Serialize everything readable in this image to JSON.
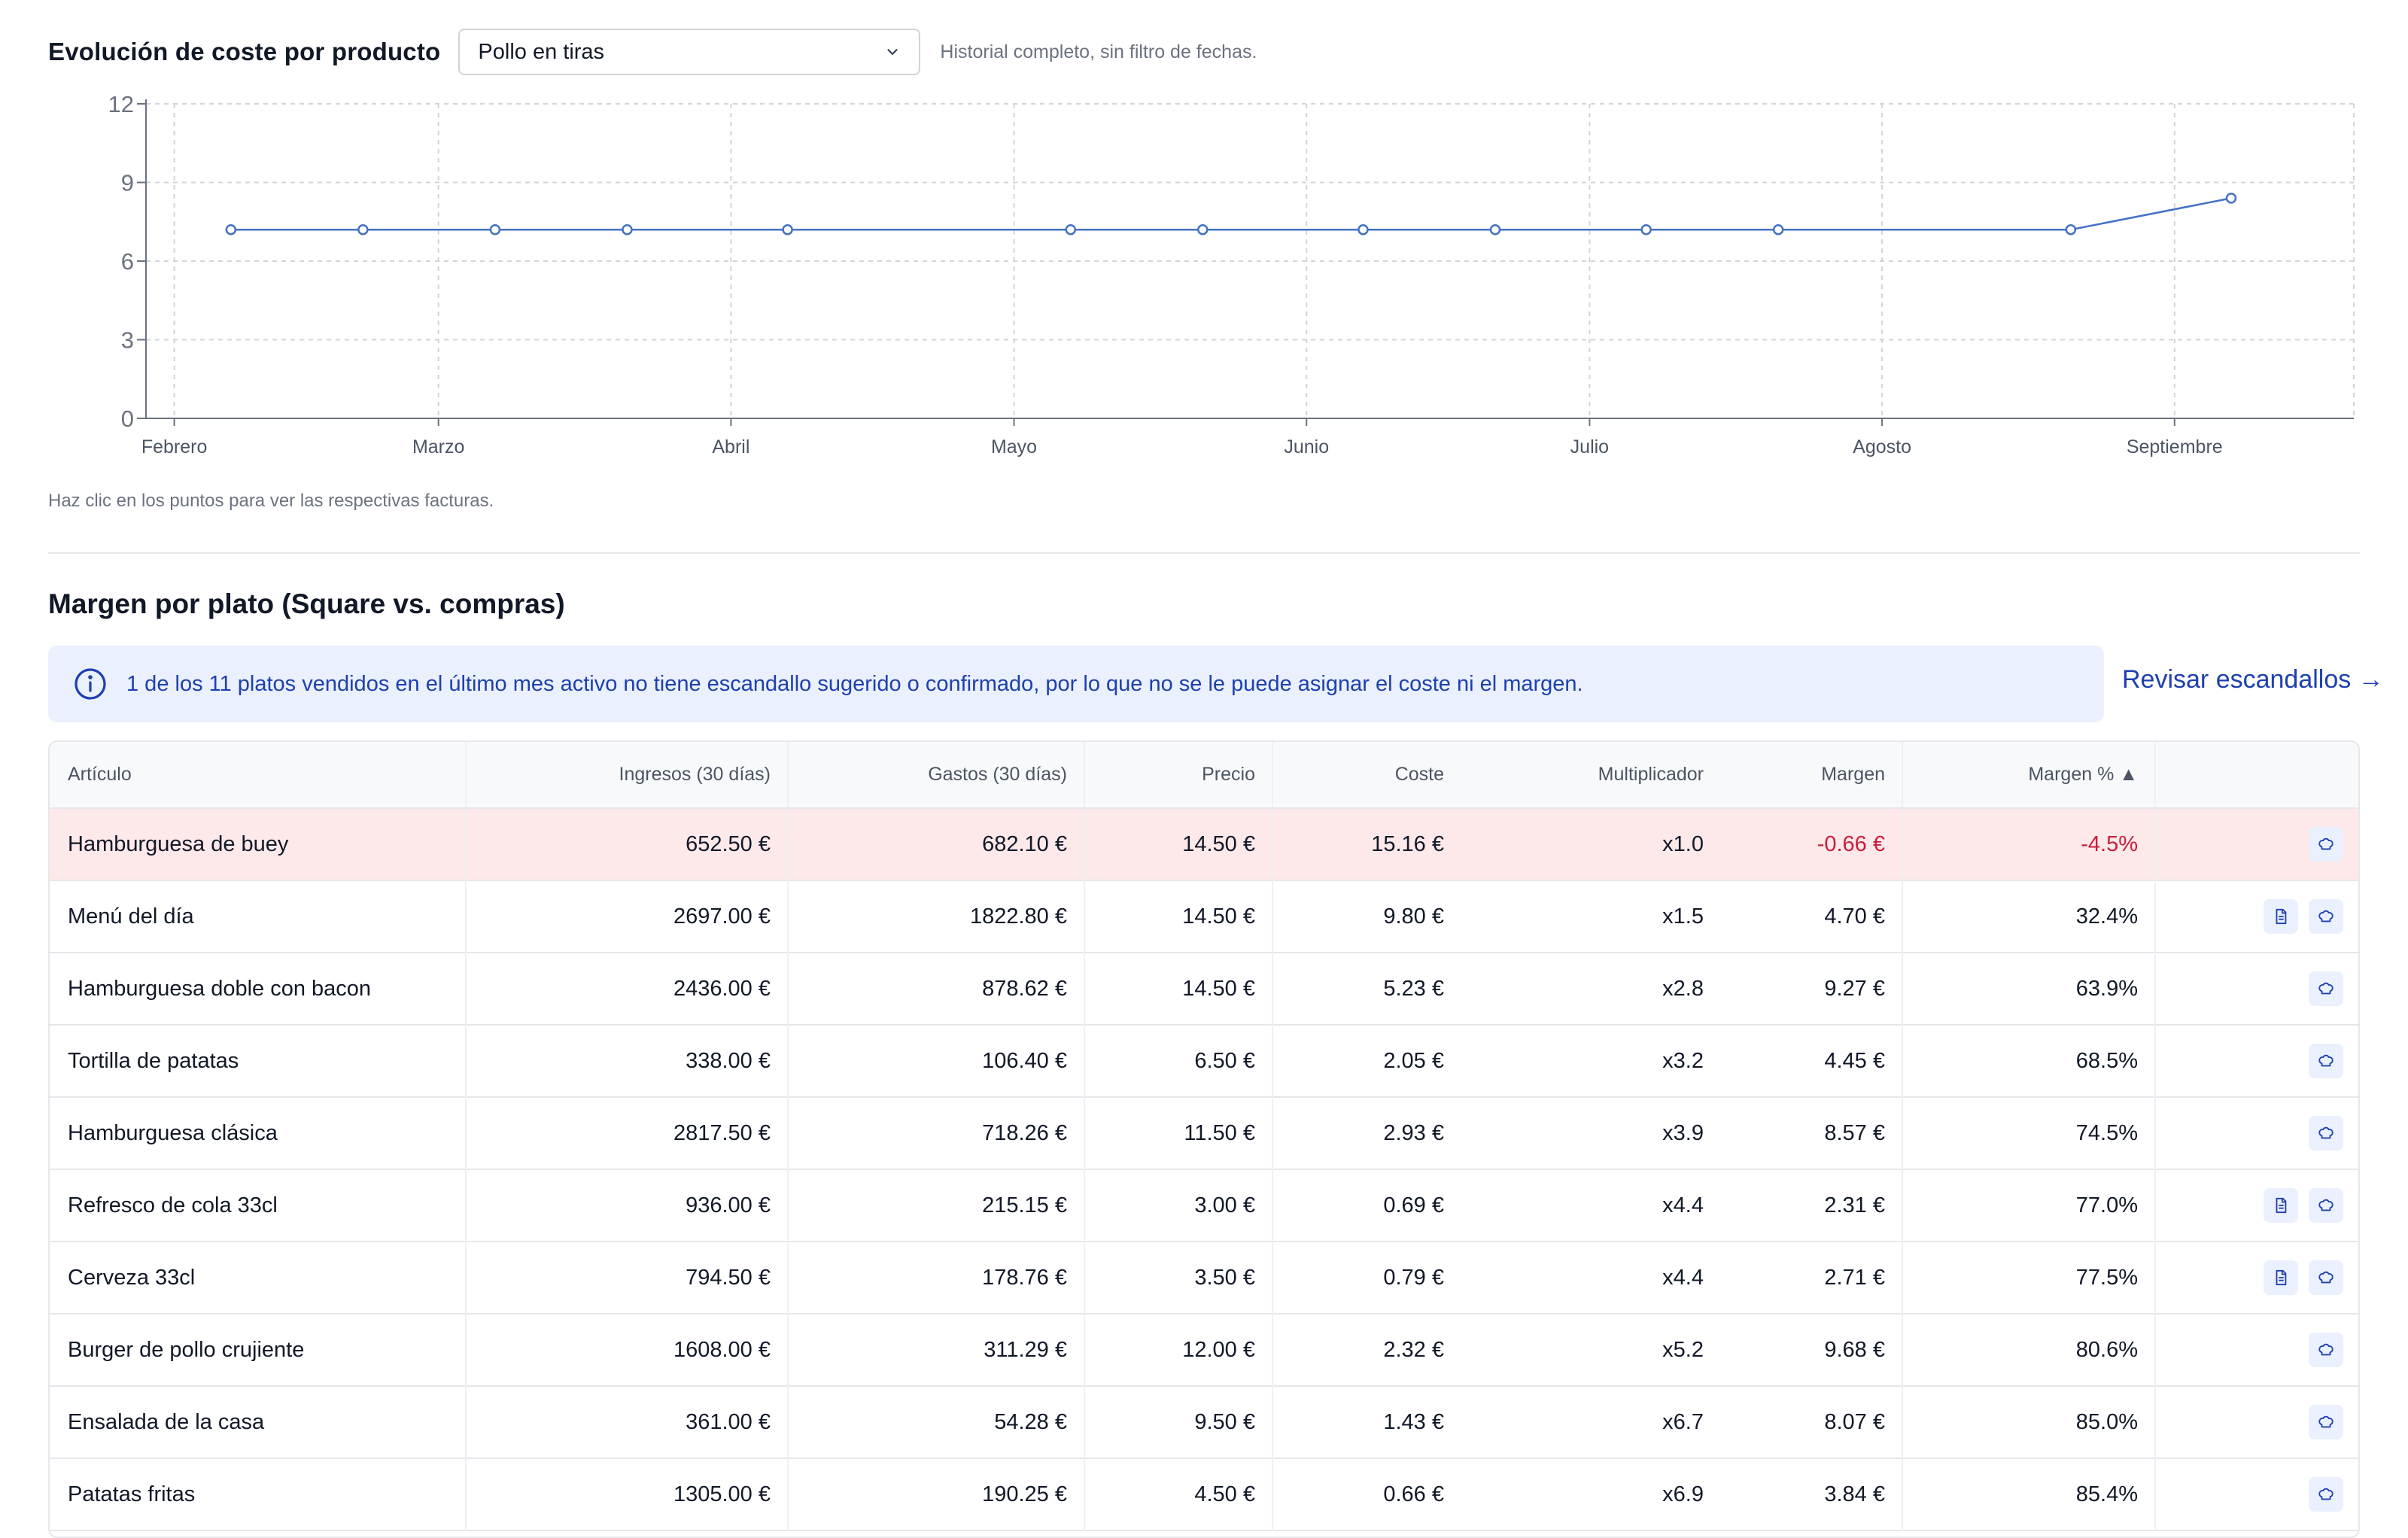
{
  "cost_section": {
    "title": "Evolución de coste por producto",
    "selected_product": "Pollo en tiras",
    "note": "Historial completo, sin filtro de fechas.",
    "hint": "Haz clic en los puntos para ver las respectivas facturas."
  },
  "chart_data": {
    "type": "line",
    "title": "",
    "xlabel": "",
    "ylabel": "",
    "ylim": [
      0,
      12
    ],
    "yticks": [
      0,
      3,
      6,
      9,
      12
    ],
    "xlim": [
      "2025-01-29",
      "2025-09-20"
    ],
    "xtick_labels": [
      {
        "date": "2025-02-01",
        "label": "Febrero"
      },
      {
        "date": "2025-03-01",
        "label": "Marzo"
      },
      {
        "date": "2025-04-01",
        "label": "Abril"
      },
      {
        "date": "2025-05-01",
        "label": "Mayo"
      },
      {
        "date": "2025-06-01",
        "label": "Junio"
      },
      {
        "date": "2025-07-01",
        "label": "Julio"
      },
      {
        "date": "2025-08-01",
        "label": "Agosto"
      },
      {
        "date": "2025-09-01",
        "label": "Septiembre"
      }
    ],
    "grid": true,
    "color": "#4472c4",
    "series": [
      {
        "points": [
          {
            "x": "2025-02-07",
            "y": 7.2
          },
          {
            "x": "2025-02-21",
            "y": 7.2
          },
          {
            "x": "2025-03-07",
            "y": 7.2
          },
          {
            "x": "2025-03-21",
            "y": 7.2
          },
          {
            "x": "2025-04-07",
            "y": 7.2
          },
          {
            "x": "2025-05-07",
            "y": 7.2
          },
          {
            "x": "2025-05-21",
            "y": 7.2
          },
          {
            "x": "2025-06-07",
            "y": 7.2
          },
          {
            "x": "2025-06-21",
            "y": 7.2
          },
          {
            "x": "2025-07-07",
            "y": 7.2
          },
          {
            "x": "2025-07-21",
            "y": 7.2
          },
          {
            "x": "2025-08-21",
            "y": 7.2
          },
          {
            "x": "2025-09-07",
            "y": 8.4
          }
        ]
      }
    ]
  },
  "margin_section": {
    "title": "Margen por plato (Square vs. compras)",
    "info_text": "1 de los 11 platos vendidos en el último mes activo no tiene escandallo sugerido o confirmado, por lo que no se le puede asignar el coste ni el margen.",
    "review_link": "Revisar escandallos →",
    "columns": [
      "Artículo",
      "Ingresos (30 días)",
      "Gastos (30 días)",
      "Precio",
      "Coste",
      "Multiplicador",
      "Margen",
      "Margen % ▲"
    ],
    "rows": [
      {
        "name": "Hamburguesa de buey",
        "income": "652.50 €",
        "expenses": "682.10 €",
        "price": "14.50 €",
        "cost": "15.16 €",
        "multiplier": "x1.0",
        "margin": "-0.66 €",
        "margin_pct": "-4.5%",
        "negative": true,
        "has_invoice": false
      },
      {
        "name": "Menú del día",
        "income": "2697.00 €",
        "expenses": "1822.80 €",
        "price": "14.50 €",
        "cost": "9.80 €",
        "multiplier": "x1.5",
        "margin": "4.70 €",
        "margin_pct": "32.4%",
        "negative": false,
        "has_invoice": true
      },
      {
        "name": "Hamburguesa doble con bacon",
        "income": "2436.00 €",
        "expenses": "878.62 €",
        "price": "14.50 €",
        "cost": "5.23 €",
        "multiplier": "x2.8",
        "margin": "9.27 €",
        "margin_pct": "63.9%",
        "negative": false,
        "has_invoice": false
      },
      {
        "name": "Tortilla de patatas",
        "income": "338.00 €",
        "expenses": "106.40 €",
        "price": "6.50 €",
        "cost": "2.05 €",
        "multiplier": "x3.2",
        "margin": "4.45 €",
        "margin_pct": "68.5%",
        "negative": false,
        "has_invoice": false
      },
      {
        "name": "Hamburguesa clásica",
        "income": "2817.50 €",
        "expenses": "718.26 €",
        "price": "11.50 €",
        "cost": "2.93 €",
        "multiplier": "x3.9",
        "margin": "8.57 €",
        "margin_pct": "74.5%",
        "negative": false,
        "has_invoice": false
      },
      {
        "name": "Refresco de cola 33cl",
        "income": "936.00 €",
        "expenses": "215.15 €",
        "price": "3.00 €",
        "cost": "0.69 €",
        "multiplier": "x4.4",
        "margin": "2.31 €",
        "margin_pct": "77.0%",
        "negative": false,
        "has_invoice": true
      },
      {
        "name": "Cerveza 33cl",
        "income": "794.50 €",
        "expenses": "178.76 €",
        "price": "3.50 €",
        "cost": "0.79 €",
        "multiplier": "x4.4",
        "margin": "2.71 €",
        "margin_pct": "77.5%",
        "negative": false,
        "has_invoice": true
      },
      {
        "name": "Burger de pollo crujiente",
        "income": "1608.00 €",
        "expenses": "311.29 €",
        "price": "12.00 €",
        "cost": "2.32 €",
        "multiplier": "x5.2",
        "margin": "9.68 €",
        "margin_pct": "80.6%",
        "negative": false,
        "has_invoice": false
      },
      {
        "name": "Ensalada de la casa",
        "income": "361.00 €",
        "expenses": "54.28 €",
        "price": "9.50 €",
        "cost": "1.43 €",
        "multiplier": "x6.7",
        "margin": "8.07 €",
        "margin_pct": "85.0%",
        "negative": false,
        "has_invoice": false
      },
      {
        "name": "Patatas fritas",
        "income": "1305.00 €",
        "expenses": "190.25 €",
        "price": "4.50 €",
        "cost": "0.66 €",
        "multiplier": "x6.9",
        "margin": "3.84 €",
        "margin_pct": "85.4%",
        "negative": false,
        "has_invoice": false
      }
    ]
  },
  "icons": {
    "select": "chevron-down-icon",
    "info": "info-icon",
    "invoice": "document-icon",
    "recipe": "chef-hat-icon"
  },
  "colors": {
    "accent": "#1e40af",
    "negative_row": "#fde8ea",
    "negative_text": "#c81e3a",
    "info_bg": "#eaf0fd"
  }
}
